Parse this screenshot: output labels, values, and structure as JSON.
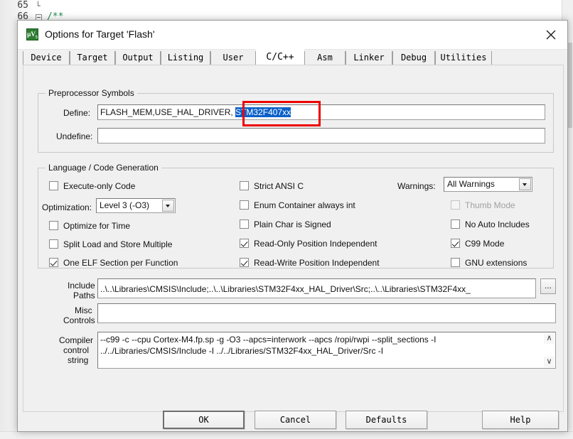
{
  "background_editor": {
    "lines": [
      {
        "number": "65",
        "code": "",
        "fold": "corner"
      },
      {
        "number": "66",
        "code": "/**",
        "fold": "box"
      }
    ],
    "right_marks": "S S S    S"
  },
  "dialog": {
    "icon": "keil-uvision-icon",
    "title": "Options for Target 'Flash'",
    "close_label": "close-icon",
    "tabs": [
      {
        "label": "Device",
        "active": false
      },
      {
        "label": "Target",
        "active": false
      },
      {
        "label": "Output",
        "active": false
      },
      {
        "label": "Listing",
        "active": false
      },
      {
        "label": "User",
        "active": false
      },
      {
        "label": "C/C++",
        "active": true
      },
      {
        "label": "Asm",
        "active": false
      },
      {
        "label": "Linker",
        "active": false
      },
      {
        "label": "Debug",
        "active": false
      },
      {
        "label": "Utilities",
        "active": false
      }
    ],
    "preprocessor": {
      "group_title": "Preprocessor Symbols",
      "define_label": "Define:",
      "define_value_plain": "FLASH_MEM,USE_HAL_DRIVER, ",
      "define_value_selected": "STM32F407xx",
      "undefine_label": "Undefine:",
      "undefine_value": ""
    },
    "language": {
      "group_title": "Language / Code Generation",
      "left_checks": [
        {
          "label": "Execute-only Code",
          "checked": false,
          "disabled": false
        },
        {
          "label": "Optimize for Time",
          "checked": false,
          "disabled": false
        },
        {
          "label": "Split Load and Store Multiple",
          "checked": false,
          "disabled": false
        },
        {
          "label": "One ELF Section per Function",
          "checked": true,
          "disabled": false
        }
      ],
      "optimization_label": "Optimization:",
      "optimization_value": "Level 3 (-O3)",
      "mid_checks": [
        {
          "label": "Strict ANSI C",
          "checked": false,
          "disabled": false
        },
        {
          "label": "Enum Container always int",
          "checked": false,
          "disabled": false
        },
        {
          "label": "Plain Char is Signed",
          "checked": false,
          "disabled": false
        },
        {
          "label": "Read-Only Position Independent",
          "checked": true,
          "disabled": false
        },
        {
          "label": "Read-Write Position Independent",
          "checked": true,
          "disabled": false
        }
      ],
      "warnings_label": "Warnings:",
      "warnings_value": "All Warnings",
      "right_checks": [
        {
          "label": "Thumb Mode",
          "checked": false,
          "disabled": true
        },
        {
          "label": "No Auto Includes",
          "checked": false,
          "disabled": false
        },
        {
          "label": "C99 Mode",
          "checked": true,
          "disabled": false
        },
        {
          "label": "GNU extensions",
          "checked": false,
          "disabled": false
        }
      ]
    },
    "paths": {
      "include_label_line1": "Include",
      "include_label_line2": "Paths",
      "include_value": "..\\..\\Libraries\\CMSIS\\Include;..\\..\\Libraries\\STM32F4xx_HAL_Driver\\Src;..\\..\\Libraries\\STM32F4xx_",
      "browse_label": "...",
      "misc_label_line1": "Misc",
      "misc_label_line2": "Controls",
      "misc_value": "",
      "compiler_label_line1": "Compiler",
      "compiler_label_line2": "control",
      "compiler_label_line3": "string",
      "compiler_value_line1": "--c99 -c --cpu Cortex-M4.fp.sp -g -O3 --apcs=interwork --apcs /ropi/rwpi --split_sections -I",
      "compiler_value_line2": "../../Libraries/CMSIS/Include -I ../../Libraries/STM32F4xx_HAL_Driver/Src -I",
      "scroll_up": "∧",
      "scroll_down": "∨"
    },
    "buttons": [
      {
        "label": "OK",
        "default": true
      },
      {
        "label": "Cancel",
        "default": false
      },
      {
        "label": "Defaults",
        "default": false
      },
      {
        "label": "Help",
        "default": false
      }
    ]
  },
  "annotation": {
    "color": "#ee0000",
    "target": "STM32F407xx"
  }
}
